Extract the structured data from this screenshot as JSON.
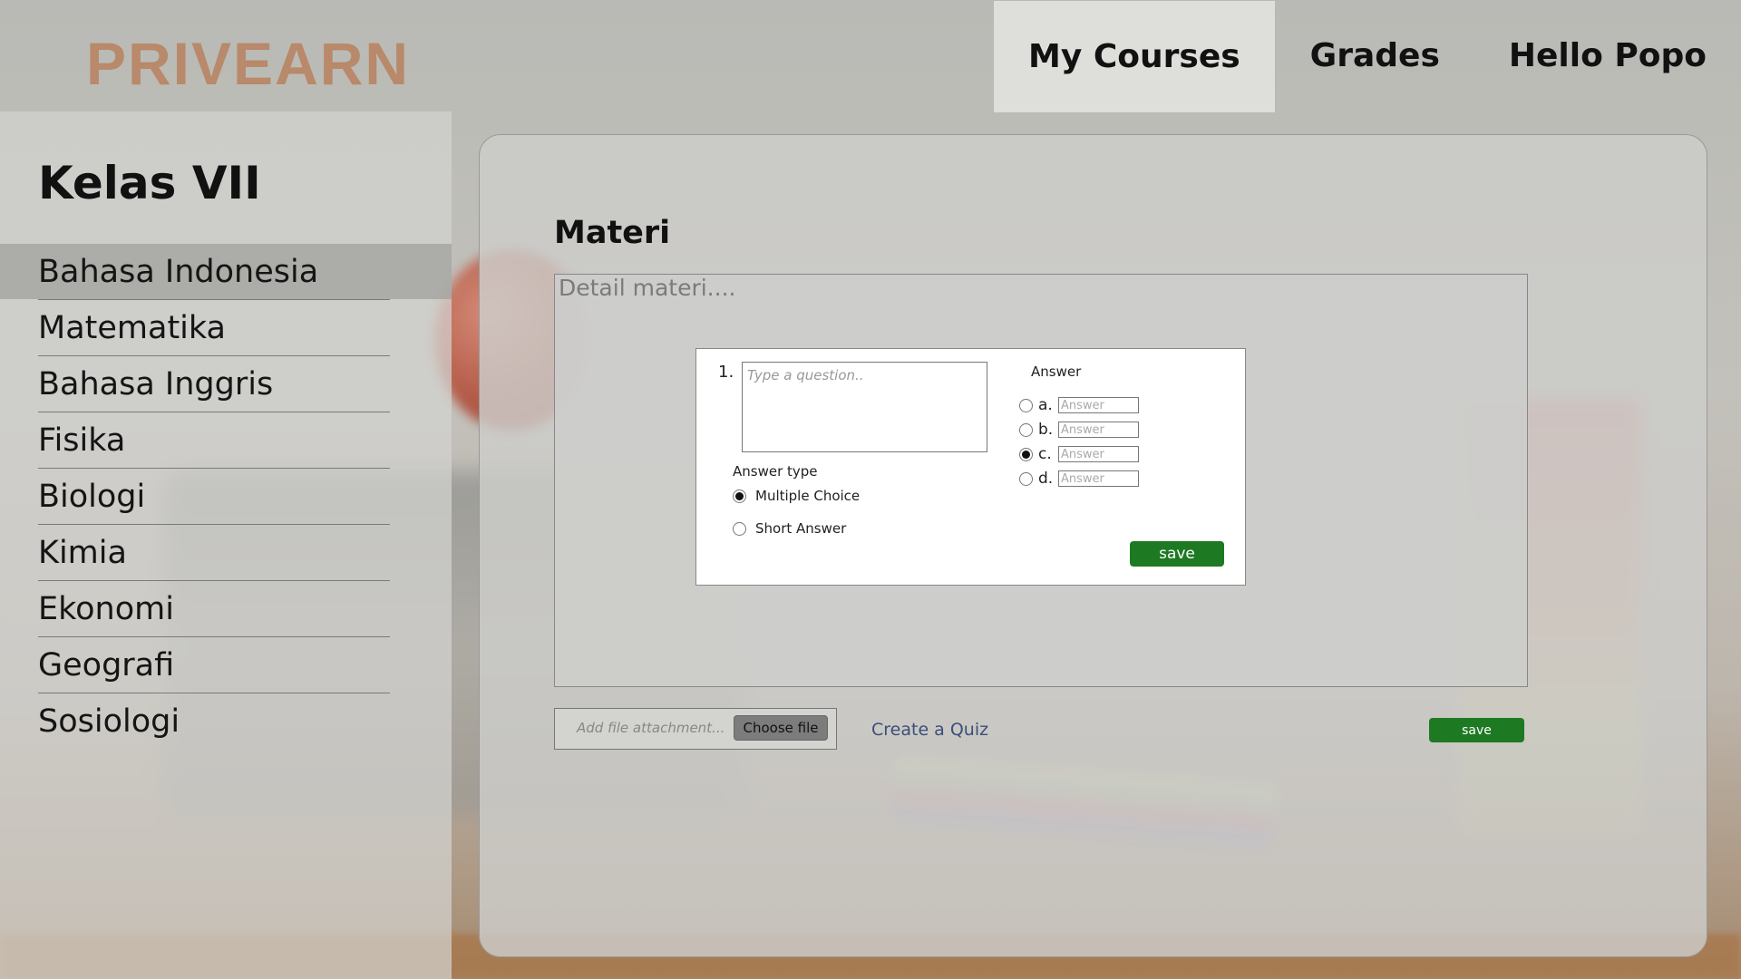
{
  "brand": {
    "logo": "PRIVEARN"
  },
  "nav": {
    "items": [
      {
        "label": "My Courses",
        "active": true
      },
      {
        "label": "Grades",
        "active": false
      },
      {
        "label": "Hello Popo",
        "active": false
      }
    ]
  },
  "sidebar": {
    "title": "Kelas VII",
    "items": [
      {
        "label": "Bahasa Indonesia",
        "active": true
      },
      {
        "label": "Matematika"
      },
      {
        "label": "Bahasa Inggris"
      },
      {
        "label": "Fisika"
      },
      {
        "label": "Biologi"
      },
      {
        "label": "Kimia"
      },
      {
        "label": "Ekonomi"
      },
      {
        "label": "Geografi"
      },
      {
        "label": "Sosiologi"
      }
    ]
  },
  "main": {
    "title": "Materi",
    "detail_placeholder": "Detail materi....",
    "quiz": {
      "number": "1.",
      "question_placeholder": "Type a question..",
      "answer_type_label": "Answer type",
      "answer_types": [
        {
          "label": "Multiple Choice",
          "selected": true
        },
        {
          "label": "Short Answer",
          "selected": false
        }
      ],
      "answer_label": "Answer",
      "answers": [
        {
          "letter": "a.",
          "placeholder": "Answer",
          "selected": false
        },
        {
          "letter": "b.",
          "placeholder": "Answer",
          "selected": false
        },
        {
          "letter": "c.",
          "placeholder": "Answer",
          "selected": true
        },
        {
          "letter": "d.",
          "placeholder": "Answer",
          "selected": false
        }
      ],
      "save_label": "save"
    },
    "file": {
      "placeholder": "Add file attachment...",
      "choose_label": "Choose file"
    },
    "create_quiz_label": "Create a Quiz",
    "save_label": "save"
  },
  "colors": {
    "logo": "#b8896a",
    "save_button": "#1d7a22",
    "link": "#3a4f7a"
  }
}
